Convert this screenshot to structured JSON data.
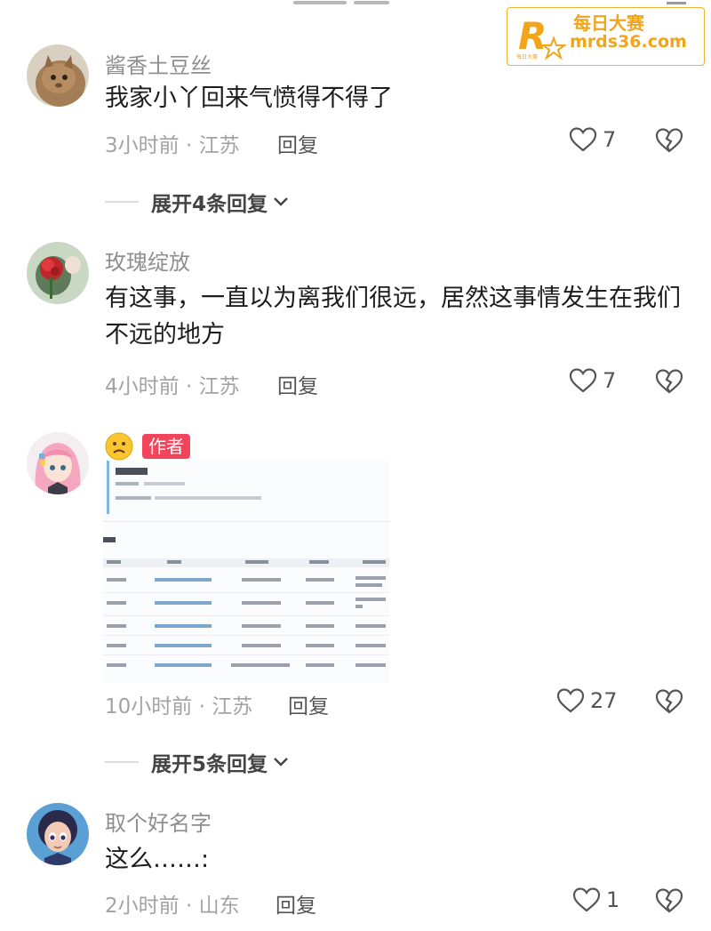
{
  "watermark": {
    "line1": "每日大赛",
    "line2": "mrds36.com"
  },
  "comments": [
    {
      "username": "酱香土豆丝",
      "text": "我家小丫回来气愤得不得了",
      "time_location": "3小时前 · 江苏",
      "reply_label": "回复",
      "likes": "7"
    },
    {
      "username": "玫瑰绽放",
      "text": "有这事，一直以为离我们很远，居然这事情发生在我们不远的地方",
      "time_location": "4小时前 · 江苏",
      "reply_label": "回复",
      "likes": "7"
    },
    {
      "username": "",
      "author_badge": "作者",
      "time_location": "10小时前 · 江苏",
      "reply_label": "回复",
      "likes": "27"
    },
    {
      "username": "取个好名字",
      "text": "这么……:",
      "time_location": "2小时前 · 山东",
      "reply_label": "回复",
      "likes": "1"
    }
  ],
  "expand_replies": [
    {
      "label": "展开4条回复"
    },
    {
      "label": "展开5条回复"
    }
  ],
  "icons": {
    "like": "heart-outline-icon",
    "dislike": "broken-heart-icon",
    "expand": "chevron-down-icon",
    "emoji": "frowning-face-icon"
  },
  "colors": {
    "author_badge": "#f2445a",
    "watermark": "#f2a51a",
    "meta": "#a3a3a3"
  }
}
